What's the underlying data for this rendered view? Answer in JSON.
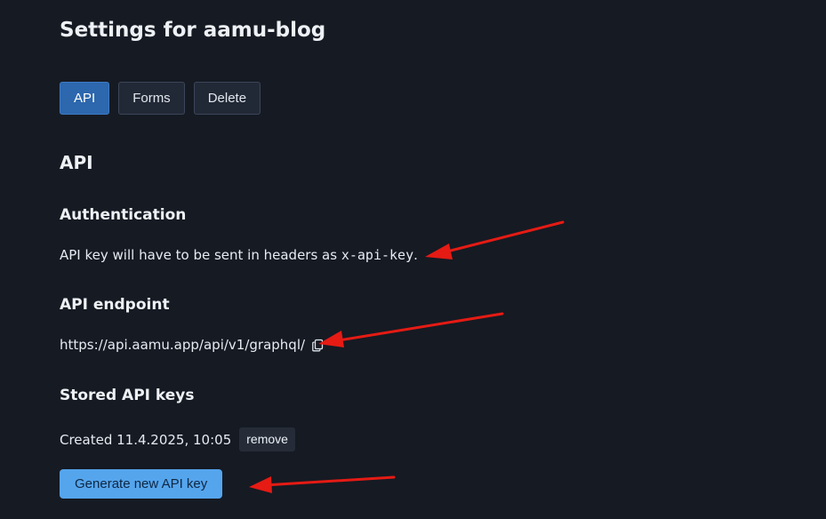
{
  "page": {
    "title": "Settings for aamu-blog"
  },
  "tabs": [
    {
      "label": "API",
      "active": true
    },
    {
      "label": "Forms",
      "active": false
    },
    {
      "label": "Delete",
      "active": false
    }
  ],
  "api_section": {
    "title": "API",
    "authentication": {
      "title": "Authentication",
      "text_before": "API key will have to be sent in headers as ",
      "header_name": "x-api-key",
      "text_after": "."
    },
    "endpoint": {
      "title": "API endpoint",
      "url": "https://api.aamu.app/api/v1/graphql/",
      "copy_icon": "copy-icon"
    },
    "stored_keys": {
      "title": "Stored API keys",
      "keys": [
        {
          "created_label": "Created 11.4.2025, 10:05",
          "remove_label": "remove"
        }
      ],
      "generate_label": "Generate new API key"
    }
  },
  "annotations": {
    "arrow_color": "#e51b14"
  },
  "colors": {
    "background": "#161a23",
    "active_tab": "#2d67ad",
    "primary_button": "#55a5ed"
  }
}
